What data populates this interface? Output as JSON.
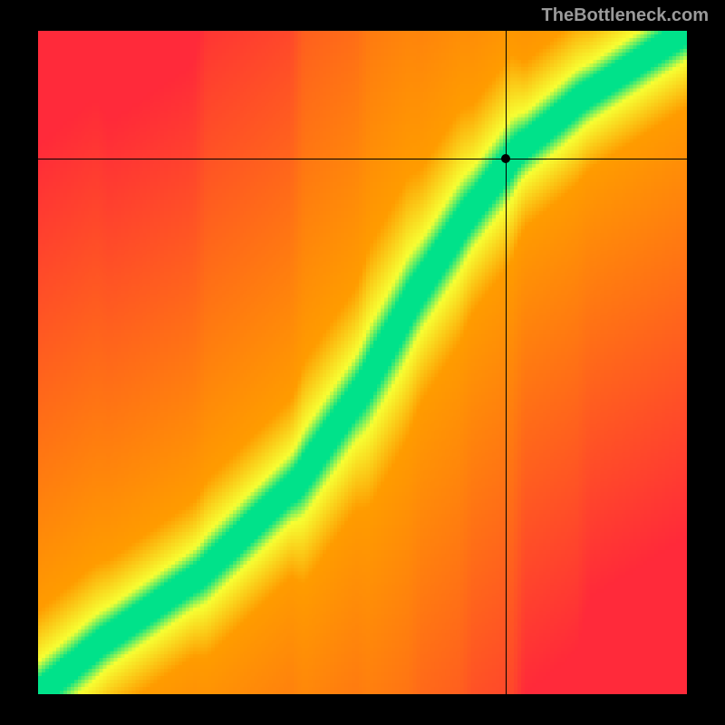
{
  "attribution": "TheBottleneck.com",
  "chart_data": {
    "type": "heatmap",
    "title": "",
    "xlabel": "",
    "ylabel": "",
    "xlim": [
      0,
      1
    ],
    "ylim": [
      0,
      1
    ],
    "marker": {
      "x": 0.72,
      "y": 0.808
    },
    "crosshair": {
      "x": 0.72,
      "y": 0.808
    },
    "optimal_band": {
      "description": "diagonal green band indicating optimal match region",
      "control_points": [
        {
          "x": 0.0,
          "y": 0.0
        },
        {
          "x": 0.1,
          "y": 0.08
        },
        {
          "x": 0.25,
          "y": 0.18
        },
        {
          "x": 0.4,
          "y": 0.32
        },
        {
          "x": 0.5,
          "y": 0.46
        },
        {
          "x": 0.58,
          "y": 0.6
        },
        {
          "x": 0.66,
          "y": 0.72
        },
        {
          "x": 0.74,
          "y": 0.82
        },
        {
          "x": 0.84,
          "y": 0.9
        },
        {
          "x": 1.0,
          "y": 1.0
        }
      ],
      "band_width": 0.07
    },
    "color_scale": {
      "optimal": "#00e28a",
      "near": "#f7ff33",
      "mid": "#ff9c00",
      "far": "#ff2a3a"
    }
  }
}
